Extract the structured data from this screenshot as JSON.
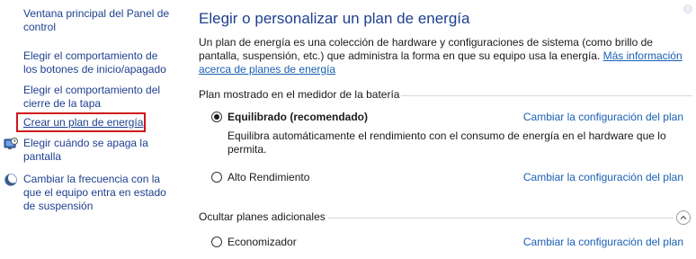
{
  "sidebar": {
    "items": [
      {
        "label": "Ventana principal del Panel de control"
      },
      {
        "label": "Elegir el comportamiento de los botones de inicio/apagado"
      },
      {
        "label": "Elegir el comportamiento del cierre de la tapa"
      },
      {
        "label": "Crear un plan de energía"
      },
      {
        "label": "Elegir cuándo se apaga la pantalla",
        "icon": "display-clock-icon"
      },
      {
        "label": "Cambiar la frecuencia con la que el equipo entra en estado de suspensión",
        "icon": "moon-icon"
      }
    ]
  },
  "main": {
    "title": "Elegir o personalizar un plan de energía",
    "description": "Un plan de energía es una colección de hardware y configuraciones de sistema (como brillo de pantalla, suspensión, etc.) que administra la forma en que su equipo usa la energía.",
    "more_info_link": "Más información acerca de planes de energía",
    "battery_group_label": "Plan mostrado en el medidor de la batería",
    "hidden_group_label": "Ocultar planes adicionales",
    "plans": [
      {
        "name": "Equilibrado (recomendado)",
        "selected": true,
        "link": "Cambiar la configuración del plan",
        "description": "Equilibra automáticamente el rendimiento con el consumo de energía en el hardware que lo permita."
      },
      {
        "name": "Alto Rendimiento",
        "selected": false,
        "link": "Cambiar la configuración del plan"
      },
      {
        "name": "Economizador",
        "selected": false,
        "link": "Cambiar la configuración del plan"
      }
    ]
  }
}
